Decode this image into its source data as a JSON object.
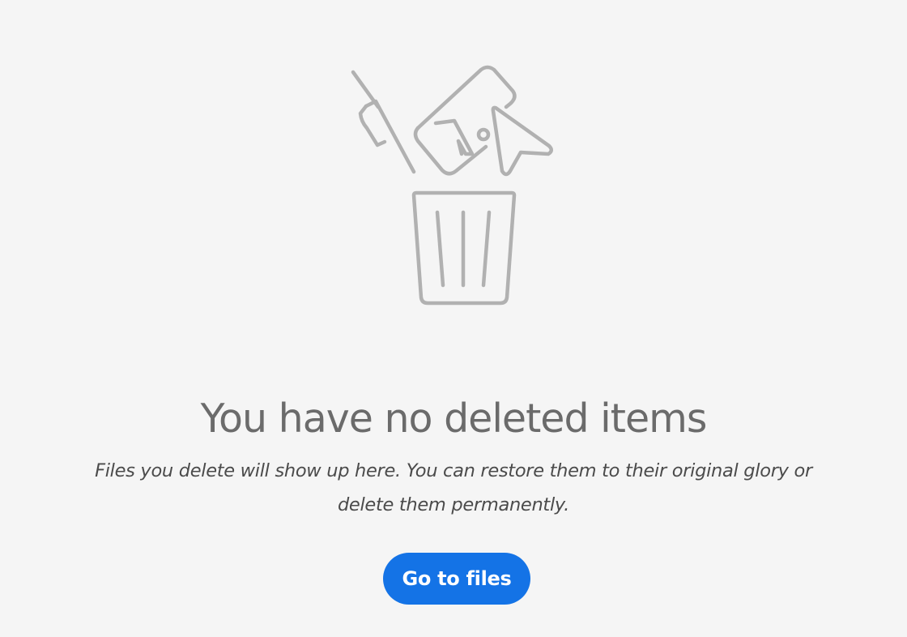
{
  "empty_state": {
    "title": "You have no deleted items",
    "description": "Files you delete will show up here. You can restore them to their original glory or delete them permanently.",
    "button_label": "Go to files"
  },
  "colors": {
    "background": "#f5f5f5",
    "title_text": "#6b6b6b",
    "body_text": "#4b4b4b",
    "illustration_stroke": "#b1b1b1",
    "primary_button": "#1473e6",
    "button_text": "#ffffff"
  },
  "icons": {
    "illustration": "trash-can-with-falling-items",
    "items": [
      "pen-icon",
      "image-file-icon",
      "cursor-arrow-icon",
      "trash-can-icon"
    ]
  }
}
